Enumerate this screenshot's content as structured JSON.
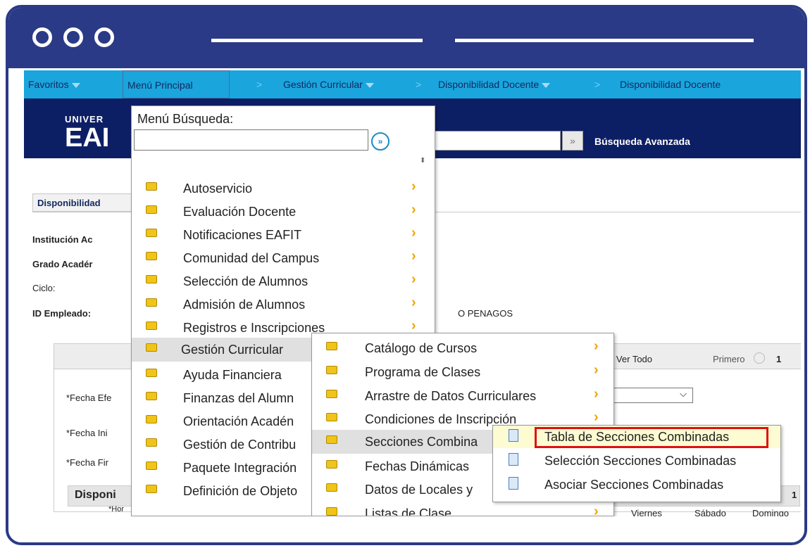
{
  "nav": {
    "favoritos": "Favoritos",
    "menu_principal": "Menú Principal",
    "gestion_curricular": "Gestión Curricular",
    "disponibilidad_docente_1": "Disponibilidad Docente",
    "disponibilidad_docente_2": "Disponibilidad Docente",
    "sep": ">"
  },
  "banner": {
    "logo_small": "UNIVER",
    "logo_big": "EAI",
    "search_btn": "»",
    "advanced": "Búsqueda Avanzada"
  },
  "page": {
    "tab": "Disponibilidad",
    "institucion": "Institución Ac",
    "grado": "Grado Acadér",
    "ciclo": "Ciclo:",
    "id_empleado": "ID Empleado:",
    "empleado_nombre": "O PENAGOS",
    "ver_todo": "r | Ver Todo",
    "primero": "Primero",
    "paging": "1",
    "fecha_ef": "*Fecha Efe",
    "fecha_ini": "*Fecha Ini",
    "fecha_fin": "*Fecha Fir",
    "disponi": "Disponi",
    "hora": "*Hor",
    "col_1": "1",
    "viernes": "Viernes",
    "sabado": "Sábado",
    "domingo": "Domingo"
  },
  "menu": {
    "title": "Menú Búsqueda:",
    "go": "»",
    "sort": "⬍",
    "items": [
      "Autoservicio",
      "Evaluación Docente",
      "Notificaciones EAFIT",
      "Comunidad del Campus",
      "Selección de Alumnos",
      "Admisión de Alumnos",
      "Registros e Inscripciones",
      "Gestión Curricular",
      "Ayuda Financiera",
      "Finanzas del Alumn",
      "Orientación Acadén",
      "Gestión de Contribu",
      "Paquete Integración",
      "Definición de Objeto"
    ]
  },
  "submenu": {
    "items": [
      "Catálogo de Cursos",
      "Programa de Clases",
      "Arrastre de Datos Curriculares",
      "Condiciones de Inscripción",
      "Secciones Combina",
      "Fechas Dinámicas",
      "Datos de Locales y",
      "Listas de Clase"
    ]
  },
  "subsubmenu": {
    "items": [
      "Tabla de Secciones Combinadas",
      "Selección Secciones Combinadas",
      "Asociar Secciones Combinadas"
    ]
  },
  "colors": {
    "frame": "#2b3a86",
    "nav": "#1aa5dd",
    "banner": "#0d1f64",
    "highlight": "#e01010"
  }
}
